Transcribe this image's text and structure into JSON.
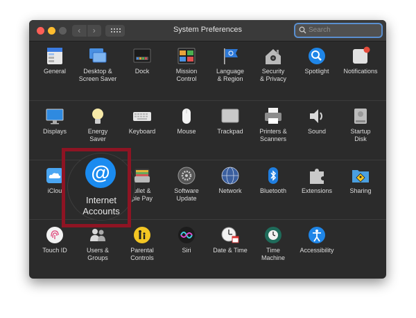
{
  "window": {
    "title": "System Preferences"
  },
  "search": {
    "placeholder": "Search"
  },
  "rows": [
    [
      {
        "label": "General",
        "icon": "general-icon"
      },
      {
        "label": "Desktop &\nScreen Saver",
        "icon": "desktop-screen-saver-icon"
      },
      {
        "label": "Dock",
        "icon": "dock-icon"
      },
      {
        "label": "Mission\nControl",
        "icon": "mission-control-icon"
      },
      {
        "label": "Language\n& Region",
        "icon": "language-region-icon"
      },
      {
        "label": "Security\n& Privacy",
        "icon": "security-privacy-icon"
      },
      {
        "label": "Spotlight",
        "icon": "spotlight-icon"
      },
      {
        "label": "Notifications",
        "icon": "notifications-icon"
      }
    ],
    [
      {
        "label": "Displays",
        "icon": "displays-icon"
      },
      {
        "label": "Energy\nSaver",
        "icon": "energy-saver-icon"
      },
      {
        "label": "Keyboard",
        "icon": "keyboard-icon"
      },
      {
        "label": "Mouse",
        "icon": "mouse-icon"
      },
      {
        "label": "Trackpad",
        "icon": "trackpad-icon"
      },
      {
        "label": "Printers &\nScanners",
        "icon": "printers-scanners-icon"
      },
      {
        "label": "Sound",
        "icon": "sound-icon"
      },
      {
        "label": "Startup\nDisk",
        "icon": "startup-disk-icon"
      }
    ],
    [
      {
        "label": "iClou",
        "icon": "icloud-icon"
      },
      {
        "label": "Internet Accounts",
        "icon": "internet-accounts-icon"
      },
      {
        "label": "ullet &\nple Pay",
        "icon": "wallet-apple-pay-icon"
      },
      {
        "label": "Software\nUpdate",
        "icon": "software-update-icon"
      },
      {
        "label": "Network",
        "icon": "network-icon"
      },
      {
        "label": "Bluetooth",
        "icon": "bluetooth-icon"
      },
      {
        "label": "Extensions",
        "icon": "extensions-icon"
      },
      {
        "label": "Sharing",
        "icon": "sharing-icon"
      }
    ],
    [
      {
        "label": "Touch ID",
        "icon": "touch-id-icon"
      },
      {
        "label": "Users &\nGroups",
        "icon": "users-groups-icon"
      },
      {
        "label": "Parental\nControls",
        "icon": "parental-controls-icon"
      },
      {
        "label": "Siri",
        "icon": "siri-icon"
      },
      {
        "label": "Date & Time",
        "icon": "date-time-icon"
      },
      {
        "label": "Time\nMachine",
        "icon": "time-machine-icon"
      },
      {
        "label": "Accessibility",
        "icon": "accessibility-icon"
      }
    ]
  ],
  "magnified": {
    "label": "Internet\nAccounts",
    "icon": "internet-accounts-icon",
    "symbol": "@"
  },
  "highlight_color": "#8e1423",
  "accent": "#1a8bf0"
}
